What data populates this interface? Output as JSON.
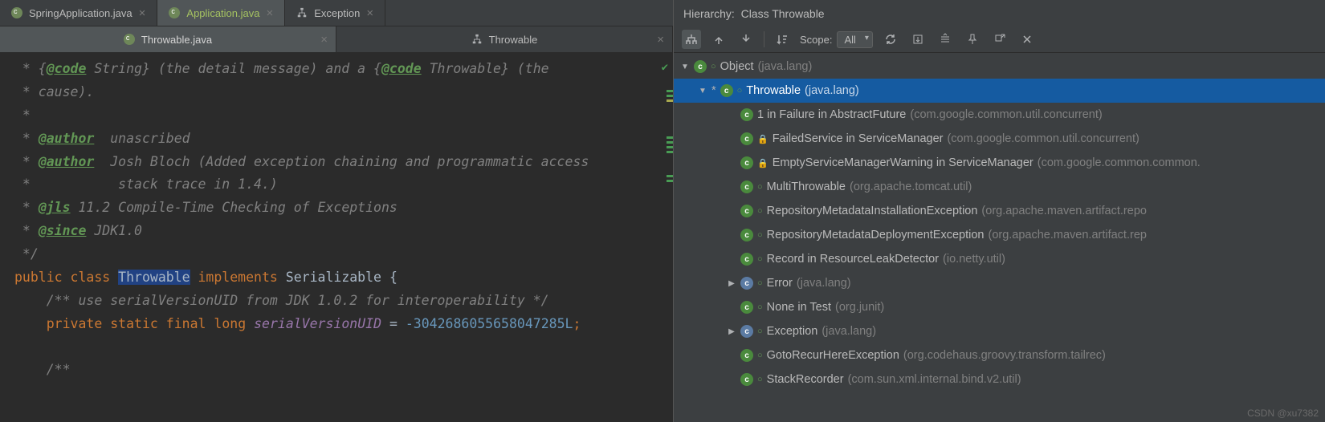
{
  "topTabs": [
    {
      "label": "SpringApplication.java",
      "icon": "java"
    },
    {
      "label": "Application.java",
      "icon": "java",
      "active": true,
      "green": true
    },
    {
      "label": "Exception",
      "icon": "struct"
    }
  ],
  "subTabs": [
    {
      "label": "Throwable.java",
      "icon": "java",
      "active": true
    },
    {
      "label": "Throwable",
      "icon": "struct"
    }
  ],
  "editor": {
    "comment_l1_pre": " * {",
    "comment_l1_tag": "@code",
    "comment_l1_mid": " String} (the detail message) and a {",
    "comment_l1_tag2": "@code",
    "comment_l1_post": " Throwable} (the",
    "comment_l2": " * cause).",
    "comment_l3": " *",
    "comment_l4_pre": " * ",
    "comment_l4_tag": "@author",
    "comment_l4_post": "  unascribed",
    "comment_l5_pre": " * ",
    "comment_l5_tag": "@author",
    "comment_l5_post": "  Josh Bloch (Added exception chaining and programmatic access",
    "comment_l6": " *           stack trace in 1.4.)",
    "comment_l7_pre": " * ",
    "comment_l7_tag": "@jls",
    "comment_l7_post": " 11.2 Compile-Time Checking of Exceptions",
    "comment_l8_pre": " * ",
    "comment_l8_tag": "@since",
    "comment_l8_post": " JDK1.0",
    "comment_l9": " */",
    "decl_kw1": "public",
    "decl_kw2": "class",
    "decl_cls": "Throwable",
    "decl_kw3": "implements",
    "decl_iface": "Serializable",
    "decl_brace": "{",
    "inner_comment": "    /** use serialVersionUID from JDK 1.0.2 for interoperability */",
    "fld_kw1": "private",
    "fld_kw2": "static",
    "fld_kw3": "final",
    "fld_kw4": "long",
    "fld_name": "serialVersionUID",
    "fld_eq": " = ",
    "fld_val": "-3042686055658047285L",
    "fld_semi": ";",
    "trailing_comment": "    /**"
  },
  "hierarchy": {
    "title_label": "Hierarchy:",
    "title_value": "Class Throwable",
    "scope_label": "Scope:",
    "scope_value": "All",
    "rows": [
      {
        "indent": 0,
        "arrow": "▼",
        "icon": "c",
        "open": true,
        "name": "Object",
        "pkg": "(java.lang)"
      },
      {
        "indent": 1,
        "arrow": "▼",
        "star": true,
        "icon": "c",
        "open": true,
        "name": "Throwable",
        "pkg": "(java.lang)",
        "sel": true
      },
      {
        "indent": 2,
        "arrow": "",
        "icon": "c",
        "open": false,
        "name": "1 in Failure in AbstractFuture",
        "pkg": "(com.google.common.util.concurrent)"
      },
      {
        "indent": 2,
        "arrow": "",
        "icon": "c",
        "lock": true,
        "name": "FailedService in ServiceManager",
        "pkg": "(com.google.common.util.concurrent)"
      },
      {
        "indent": 2,
        "arrow": "",
        "icon": "c",
        "lock": true,
        "name": "EmptyServiceManagerWarning in ServiceManager",
        "pkg": "(com.google.common.common."
      },
      {
        "indent": 2,
        "arrow": "",
        "icon": "c",
        "open": true,
        "name": "MultiThrowable",
        "pkg": "(org.apache.tomcat.util)"
      },
      {
        "indent": 2,
        "arrow": "",
        "icon": "c",
        "open": true,
        "name": "RepositoryMetadataInstallationException",
        "pkg": "(org.apache.maven.artifact.repo"
      },
      {
        "indent": 2,
        "arrow": "",
        "icon": "c",
        "open": true,
        "name": "RepositoryMetadataDeploymentException",
        "pkg": "(org.apache.maven.artifact.rep"
      },
      {
        "indent": 2,
        "arrow": "",
        "icon": "c",
        "open": true,
        "name": "Record in ResourceLeakDetector",
        "pkg": "(io.netty.util)"
      },
      {
        "indent": 2,
        "arrow": "▶",
        "icon": "abs",
        "open": true,
        "name": "Error",
        "pkg": "(java.lang)"
      },
      {
        "indent": 2,
        "arrow": "",
        "icon": "c",
        "open": true,
        "name": "None in Test",
        "pkg": "(org.junit)"
      },
      {
        "indent": 2,
        "arrow": "▶",
        "icon": "abs",
        "open": true,
        "name": "Exception",
        "pkg": "(java.lang)"
      },
      {
        "indent": 2,
        "arrow": "",
        "icon": "c",
        "open": true,
        "name": "GotoRecurHereException",
        "pkg": "(org.codehaus.groovy.transform.tailrec)"
      },
      {
        "indent": 2,
        "arrow": "",
        "icon": "c",
        "open": true,
        "name": "StackRecorder",
        "pkg": "(com.sun.xml.internal.bind.v2.util)"
      }
    ]
  },
  "watermark": "CSDN @xu7382"
}
